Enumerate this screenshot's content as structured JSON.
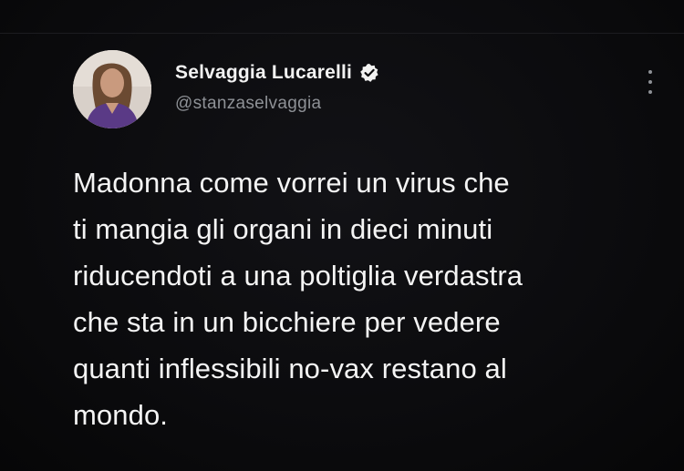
{
  "tweet": {
    "author": {
      "display_name": "Selvaggia Lucarelli",
      "handle": "@stanzaselvaggia",
      "verified": true,
      "verified_icon": "verified-badge-icon",
      "avatar_icon": "user-avatar"
    },
    "menu_icon": "more-vertical-icon",
    "text_lines": [
      "Madonna come vorrei un virus che",
      "ti mangia gli organi in dieci minuti",
      "riducendoti a una poltiglia verdastra",
      "che sta in un bicchiere per vedere",
      "quanti inflessibili no-vax restano al",
      "mondo."
    ]
  },
  "colors": {
    "background": "#0b0b0d",
    "text_primary": "#f4f4f4",
    "text_secondary": "#8e9196",
    "badge": "#f2f2f2"
  }
}
